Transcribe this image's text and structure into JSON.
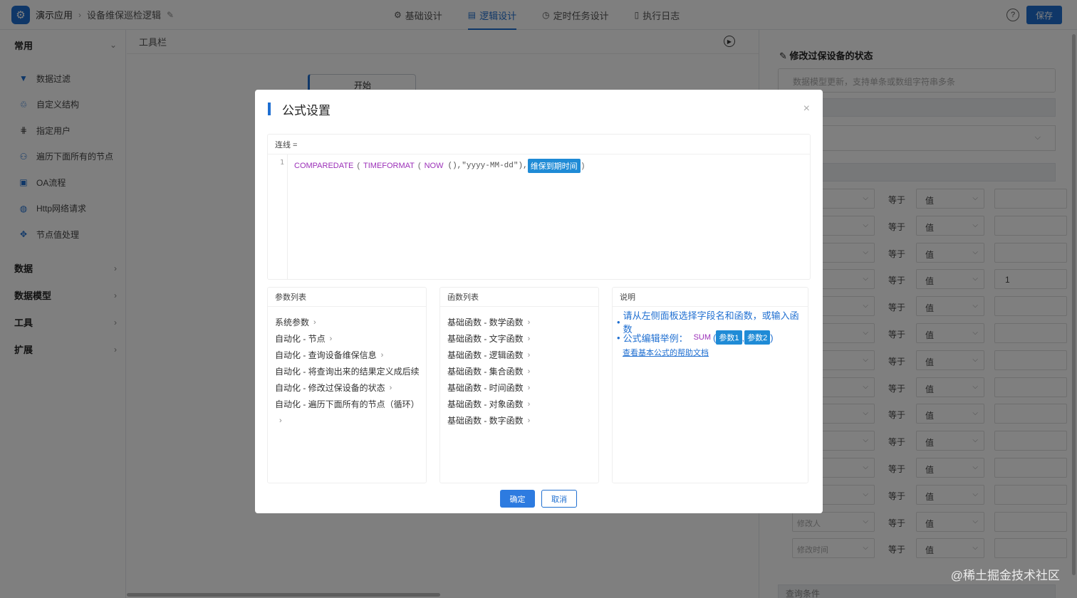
{
  "header": {
    "app_name": "演示应用",
    "breadcrumb_sep": "›",
    "page_name": "设备维保巡检逻辑",
    "tabs": [
      {
        "icon": "gear-icon",
        "label": "基础设计",
        "active": false
      },
      {
        "icon": "logic-icon",
        "label": "逻辑设计",
        "active": true
      },
      {
        "icon": "clock-icon",
        "label": "定时任务设计",
        "active": false
      },
      {
        "icon": "log-icon",
        "label": "执行日志",
        "active": false
      }
    ],
    "help": "?",
    "save_label": "保存"
  },
  "sidebar": {
    "groups": [
      {
        "label": "常用",
        "expanded": true,
        "chevron": "⌄"
      },
      {
        "label": "数据",
        "expanded": false,
        "chevron": "›"
      },
      {
        "label": "数据模型",
        "expanded": false,
        "chevron": "›"
      },
      {
        "label": "工具",
        "expanded": false,
        "chevron": "›"
      },
      {
        "label": "扩展",
        "expanded": false,
        "chevron": "›"
      }
    ],
    "items": [
      {
        "icon": "filter-icon",
        "label": "数据过滤"
      },
      {
        "icon": "structure-icon",
        "label": "自定义结构"
      },
      {
        "icon": "user-assign-icon",
        "label": "指定用户"
      },
      {
        "icon": "tree-traverse-icon",
        "label": "遍历下面所有的节点"
      },
      {
        "icon": "workflow-icon",
        "label": "OA流程"
      },
      {
        "icon": "globe-icon",
        "label": "Http网络请求"
      },
      {
        "icon": "node-value-icon",
        "label": "节点值处理"
      }
    ]
  },
  "canvas": {
    "toolbar_label": "工具栏",
    "start_node": "开始"
  },
  "right_panel": {
    "title": "修改过保设备的状态",
    "desc_placeholder": "数据模型更新，支持单条或数组字符串多条",
    "conditions": [
      {
        "field": "",
        "op": "等于",
        "type": "值",
        "value": ""
      },
      {
        "field": "",
        "op": "等于",
        "type": "值",
        "value": ""
      },
      {
        "field": "",
        "op": "等于",
        "type": "值",
        "value": ""
      },
      {
        "field": "",
        "op": "等于",
        "type": "值",
        "value": "1"
      },
      {
        "field": "",
        "op": "等于",
        "type": "值",
        "value": ""
      },
      {
        "field": "",
        "op": "等于",
        "type": "值",
        "value": ""
      },
      {
        "field": "",
        "op": "等于",
        "type": "值",
        "value": ""
      },
      {
        "field": "",
        "op": "等于",
        "type": "值",
        "value": ""
      },
      {
        "field": "",
        "op": "等于",
        "type": "值",
        "value": ""
      },
      {
        "field": "",
        "op": "等于",
        "type": "值",
        "value": ""
      },
      {
        "field": "",
        "op": "等于",
        "type": "值",
        "value": ""
      },
      {
        "field": "",
        "op": "等于",
        "type": "值",
        "value": ""
      },
      {
        "field": "修改人",
        "op": "等于",
        "type": "值",
        "value": ""
      },
      {
        "field": "修改时间",
        "op": "等于",
        "type": "值",
        "value": ""
      }
    ],
    "footer_label": "查询条件"
  },
  "modal": {
    "title": "公式设置",
    "close": "×",
    "editor": {
      "label": "连线 =",
      "line_number": "1",
      "code": {
        "fn1": "COMPAREDATE",
        "paren_open_1": "(",
        "fn2": "TIMEFORMAT",
        "paren_open_2": "(",
        "fn3": "NOW",
        "arg_str": "(),\"yyyy-MM-dd\"),",
        "field_tag": "维保到期时间",
        "paren_close": ")"
      }
    },
    "params": {
      "header": "参数列表",
      "items": [
        "系统参数",
        "自动化 - 节点",
        "自动化 - 查询设备维保信息",
        "自动化 - 将查询出来的结果定义成后续",
        "自动化 - 修改过保设备的状态",
        "自动化 - 遍历下面所有的节点（循环）"
      ]
    },
    "functions": {
      "header": "函数列表",
      "items": [
        "基础函数 - 数学函数",
        "基础函数 - 文字函数",
        "基础函数 - 逻辑函数",
        "基础函数 - 集合函数",
        "基础函数 - 时间函数",
        "基础函数 - 对象函数",
        "基础函数 - 数字函数"
      ]
    },
    "notes": {
      "header": "说明",
      "line1": "请从左侧面板选择字段名和函数，或输入函数",
      "line2_prefix": "公式编辑举例：",
      "line2_fn": "SUM",
      "line2_open": "(",
      "line2_param1": "参数1",
      "line2_comma": ",",
      "line2_param2": "参数2",
      "line2_close": ")",
      "help_link": "查看基本公式的帮助文档"
    },
    "ok_label": "确定",
    "cancel_label": "取消"
  },
  "watermark": "@稀土掘金技术社区",
  "colors": {
    "accent": "#1f6fd1",
    "tag": "#1f8bd6",
    "function": "#9b2fb8"
  }
}
